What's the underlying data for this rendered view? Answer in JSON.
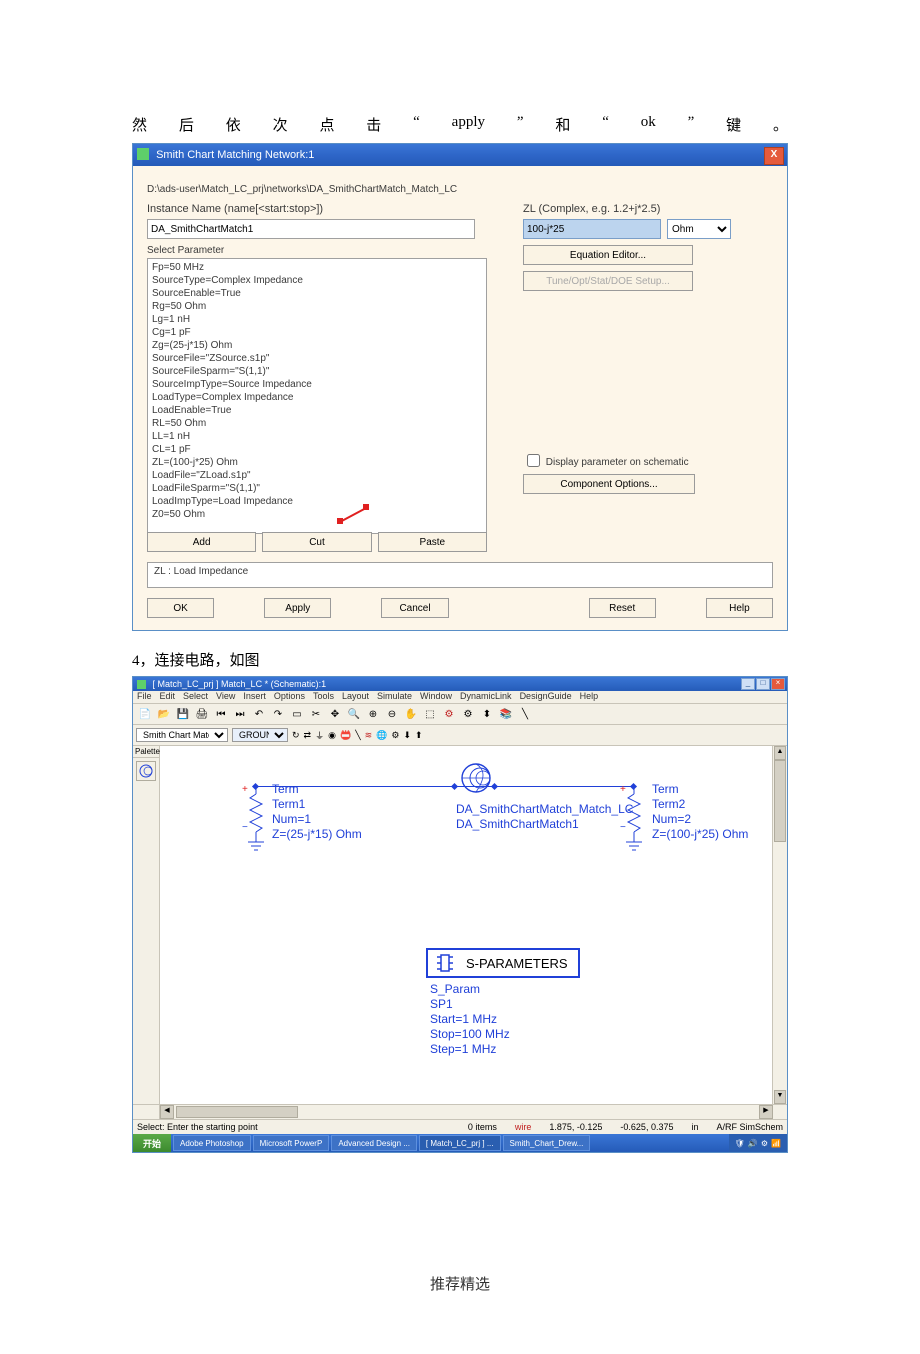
{
  "intro": {
    "full": "然后依次点击\" apply \"和\" ok \"键。"
  },
  "dialog": {
    "title": "Smith Chart Matching Network:1",
    "path": "D:\\ads-user\\Match_LC_prj\\networks\\DA_SmithChartMatch_Match_LC",
    "instance_label": "Instance Name  (name[<start:stop>])",
    "instance_value": "DA_SmithChartMatch1",
    "select_param_label": "Select Parameter",
    "params": "Fp=50 MHz\nSourceType=Complex Impedance\nSourceEnable=True\nRg=50 Ohm\nLg=1 nH\nCg=1 pF\nZg=(25-j*15) Ohm\nSourceFile=\"ZSource.s1p\"\nSourceFileSparm=\"S(1,1)\"\nSourceImpType=Source Impedance\nLoadType=Complex Impedance\nLoadEnable=True\nRL=50 Ohm\nLL=1 nH\nCL=1 pF\nZL=(100-j*25) Ohm\nLoadFile=\"ZLoad.s1p\"\nLoadFileSparm=\"S(1,1)\"\nLoadImpType=Load Impedance\nZ0=50 Ohm",
    "add": "Add",
    "cut": "Cut",
    "paste": "Paste",
    "zl_label": "ZL (Complex, e.g. 1.2+j*2.5)",
    "zl_value": "100-j*25",
    "zl_unit": "Ohm",
    "eq_editor": "Equation Editor...",
    "tune_btn": "Tune/Opt/Stat/DOE Setup...",
    "display_param": "Display parameter on schematic",
    "comp_opt": "Component Options...",
    "desc": "ZL : Load Impedance",
    "ok": "OK",
    "apply": "Apply",
    "cancel": "Cancel",
    "reset": "Reset",
    "help": "Help"
  },
  "step4": "4，连接电路，如图",
  "schem": {
    "title": "[ Match_LC_prj ] Match_LC * (Schematic):1",
    "menus": [
      "File",
      "Edit",
      "Select",
      "View",
      "Insert",
      "Options",
      "Tools",
      "Layout",
      "Simulate",
      "Window",
      "DynamicLink",
      "DesignGuide",
      "Help"
    ],
    "combo1": "Smith Chart Matching",
    "combo2": "GROUND",
    "palette": "Palette",
    "term1": {
      "label": "Term",
      "name": "Term1",
      "num": "Num=1",
      "z": "Z=(25-j*15) Ohm"
    },
    "match": {
      "line1": "DA_SmithChartMatch_Match_LC",
      "line2": "DA_SmithChartMatch1"
    },
    "term2": {
      "label": "Term",
      "name": "Term2",
      "num": "Num=2",
      "z": "Z=(100-j*25) Ohm"
    },
    "sparam": {
      "box": "S-PARAMETERS",
      "name": "S_Param",
      "inst": "SP1",
      "start": "Start=1 MHz",
      "stop": "Stop=100 MHz",
      "step": "Step=1 MHz"
    },
    "status_left": "Select: Enter the starting point",
    "status_items": "0 items",
    "status_wire": "wire",
    "status_coord1": "1.875, -0.125",
    "status_coord2": "-0.625, 0.375",
    "status_unit": "in",
    "status_mode": "A/RF  SimSchem",
    "task": {
      "start": "开始",
      "items": [
        "Adobe Photoshop",
        "Microsoft PowerP",
        "Advanced Design ...",
        "[ Match_LC_prj ] ...",
        "Smith_Chart_Drew..."
      ]
    }
  },
  "footer": "推荐精选"
}
